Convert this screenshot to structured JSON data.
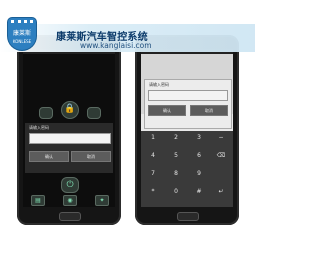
{
  "watermark": {
    "logo_text": "康莱斯",
    "logo_subtext": "KONLESE",
    "brand_name": "康莱斯汽车智控系统",
    "url": "www.kanglaisi.com"
  },
  "left_phone": {
    "dialog": {
      "title": "请输入密码",
      "input_value": "",
      "confirm_label": "确认",
      "cancel_label": "取消"
    }
  },
  "right_phone": {
    "dialog": {
      "title": "请输入密码",
      "input_value": "",
      "confirm_label": "确认",
      "cancel_label": "取消"
    },
    "keypad": {
      "keys": [
        "1",
        "2",
        "3",
        "−",
        "4",
        "5",
        "6",
        "⌫",
        "7",
        "8",
        "9",
        "",
        "*",
        "0",
        "#",
        "↵"
      ]
    }
  },
  "colors": {
    "phone_body": "#151515",
    "screen_bg": "#0d0d0d",
    "accent_green": "#7fe0b3",
    "banner_blue": "#2d7fc0"
  }
}
